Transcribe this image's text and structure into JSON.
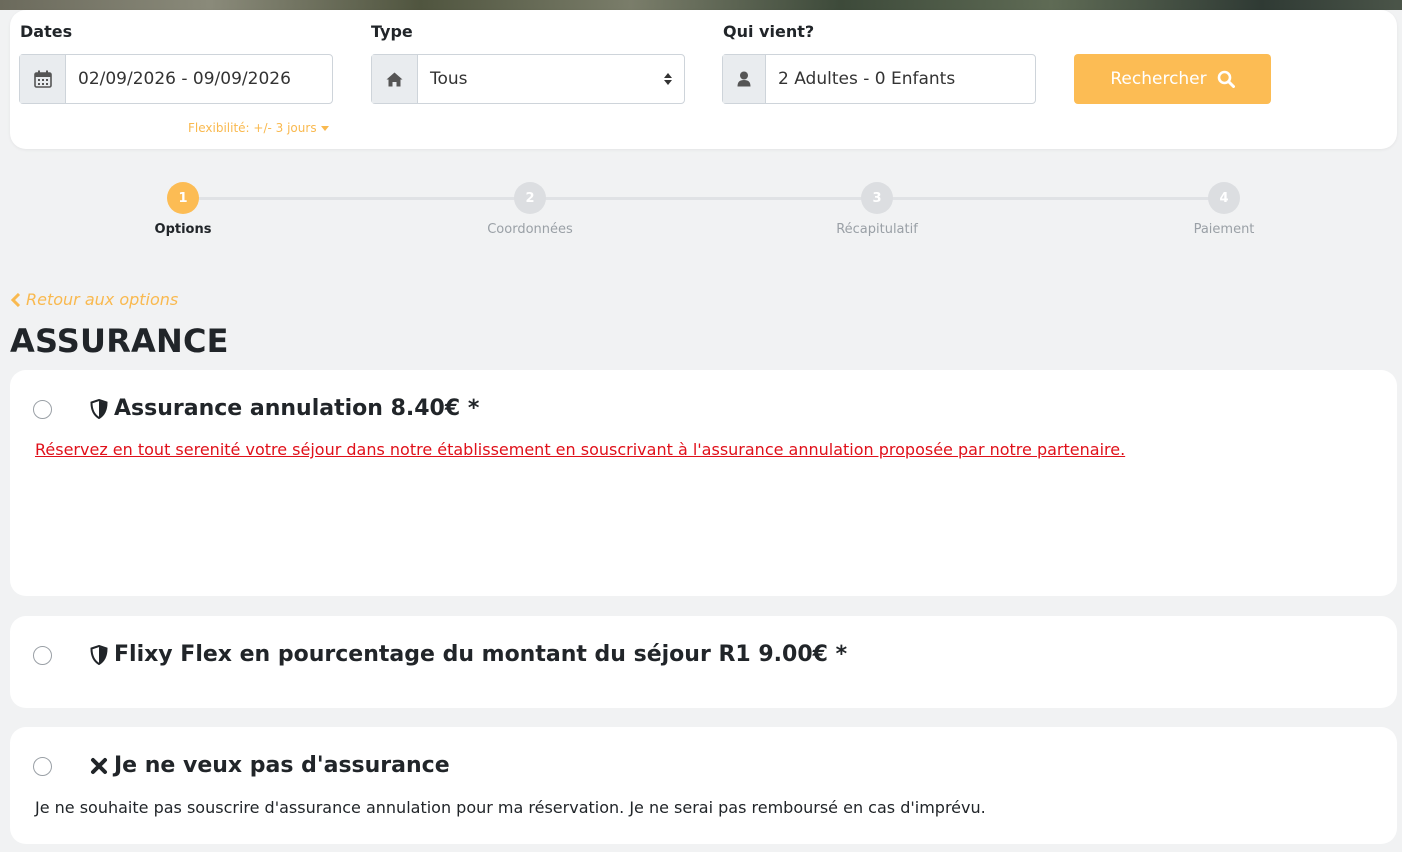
{
  "search": {
    "dates_label": "Dates",
    "dates_value": "02/09/2026 - 09/09/2026",
    "flexibility": "Flexibilité: +/- 3 jours",
    "type_label": "Type",
    "type_value": "Tous",
    "guests_label": "Qui vient?",
    "guests_value": "2 Adultes - 0 Enfants",
    "search_button": "Rechercher"
  },
  "stepper": {
    "steps": [
      {
        "number": "1",
        "label": "Options",
        "active": true
      },
      {
        "number": "2",
        "label": "Coordonnées",
        "active": false
      },
      {
        "number": "3",
        "label": "Récapitulatif",
        "active": false
      },
      {
        "number": "4",
        "label": "Paiement",
        "active": false
      }
    ]
  },
  "back_link": "Retour aux options",
  "section_title": "ASSURANCE",
  "options": [
    {
      "icon": "shield-icon",
      "title": "Assurance annulation 8.40€ *",
      "description": "Réservez en tout serenité votre séjour dans notre établissement en souscrivant à l'assurance annulation proposée par notre partenaire.",
      "selected": false
    },
    {
      "icon": "shield-icon",
      "title": "Flixy Flex en pourcentage du montant du séjour R1 9.00€ *",
      "description": "",
      "selected": false
    },
    {
      "icon": "close-icon",
      "title": "Je ne veux pas d'assurance",
      "description": "Je ne souhaite pas souscrire d'assurance annulation pour ma réservation. Je ne serai pas remboursé en cas d'imprévu.",
      "selected": false
    }
  ],
  "colors": {
    "accent": "#fcbc54",
    "link": "#f9b94f",
    "warning_text": "#e0101a",
    "background": "#f1f2f3"
  }
}
